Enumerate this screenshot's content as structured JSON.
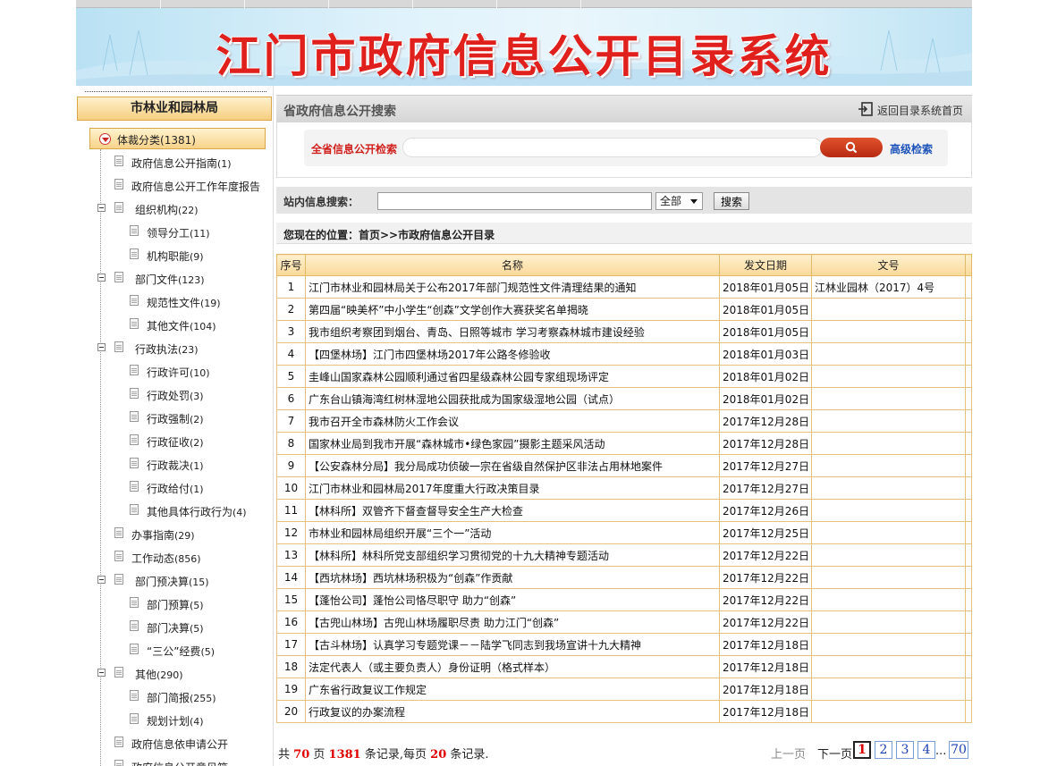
{
  "banner": {
    "title": "江门市政府信息公开目录系统"
  },
  "sidebar": {
    "header": "市林业和园林局",
    "root": {
      "label": "体裁分类",
      "count": "(1381)"
    },
    "items": [
      {
        "label": "政府信息公开指南",
        "count": "(1)",
        "level": 1,
        "type": "doc"
      },
      {
        "label": "政府信息公开工作年度报告",
        "count": "",
        "level": 1,
        "type": "doc"
      },
      {
        "label": "组织机构",
        "count": "(22)",
        "level": 1,
        "type": "folder"
      },
      {
        "label": "领导分工",
        "count": "(11)",
        "level": 2,
        "type": "doc"
      },
      {
        "label": "机构职能",
        "count": "(9)",
        "level": 2,
        "type": "doc"
      },
      {
        "label": "部门文件",
        "count": "(123)",
        "level": 1,
        "type": "folder"
      },
      {
        "label": "规范性文件",
        "count": "(19)",
        "level": 2,
        "type": "doc"
      },
      {
        "label": "其他文件",
        "count": "(104)",
        "level": 2,
        "type": "doc"
      },
      {
        "label": "行政执法",
        "count": "(23)",
        "level": 1,
        "type": "folder"
      },
      {
        "label": "行政许可",
        "count": "(10)",
        "level": 2,
        "type": "doc"
      },
      {
        "label": "行政处罚",
        "count": "(3)",
        "level": 2,
        "type": "doc"
      },
      {
        "label": "行政强制",
        "count": "(2)",
        "level": 2,
        "type": "doc"
      },
      {
        "label": "行政征收",
        "count": "(2)",
        "level": 2,
        "type": "doc"
      },
      {
        "label": "行政裁决",
        "count": "(1)",
        "level": 2,
        "type": "doc"
      },
      {
        "label": "行政给付",
        "count": "(1)",
        "level": 2,
        "type": "doc"
      },
      {
        "label": "其他具体行政行为",
        "count": "(4)",
        "level": 2,
        "type": "doc"
      },
      {
        "label": "办事指南",
        "count": "(29)",
        "level": 1,
        "type": "doc"
      },
      {
        "label": "工作动态",
        "count": "(856)",
        "level": 1,
        "type": "doc"
      },
      {
        "label": "部门预决算",
        "count": "(15)",
        "level": 1,
        "type": "folder"
      },
      {
        "label": "部门预算",
        "count": "(5)",
        "level": 2,
        "type": "doc"
      },
      {
        "label": "部门决算",
        "count": "(5)",
        "level": 2,
        "type": "doc"
      },
      {
        "label": "“三公”经费",
        "count": "(5)",
        "level": 2,
        "type": "doc"
      },
      {
        "label": "其他",
        "count": "(290)",
        "level": 1,
        "type": "folder"
      },
      {
        "label": "部门简报",
        "count": "(255)",
        "level": 2,
        "type": "doc"
      },
      {
        "label": "规划计划",
        "count": "(4)",
        "level": 2,
        "type": "doc"
      },
      {
        "label": "政府信息依申请公开",
        "count": "",
        "level": 1,
        "type": "doc"
      },
      {
        "label": "政府信息公开意见箱",
        "count": "",
        "level": 1,
        "type": "doc"
      }
    ]
  },
  "search": {
    "title": "省政府信息公开搜索",
    "back_label": "返回目录系统首页",
    "province_label": "全省信息公开检索",
    "province_value": "",
    "advanced_label": "高级检索"
  },
  "site_search": {
    "label": "站内信息搜索：",
    "value": "",
    "scope": "全部",
    "button": "搜索"
  },
  "location": {
    "text": "您现在的位置：首页>>市政府信息公开目录"
  },
  "table": {
    "headers": [
      "序号",
      "名称",
      "发文日期",
      "文号"
    ],
    "rows": [
      [
        "1",
        "江门市林业和园林局关于公布2017年部门规范性文件清理结果的通知",
        "2018年01月05日",
        "江林业园林（2017）4号"
      ],
      [
        "2",
        "第四届“映美杯”中小学生“创森”文学创作大赛获奖名单揭晓",
        "2018年01月05日",
        ""
      ],
      [
        "3",
        "我市组织考察团到烟台、青岛、日照等城市  学习考察森林城市建设经验",
        "2018年01月05日",
        ""
      ],
      [
        "4",
        "【四堡林场】江门市四堡林场2017年公路冬修验收",
        "2018年01月03日",
        ""
      ],
      [
        "5",
        "圭峰山国家森林公园顺利通过省四星级森林公园专家组现场评定",
        "2018年01月02日",
        ""
      ],
      [
        "6",
        "广东台山镇海湾红树林湿地公园获批成为国家级湿地公园（试点）",
        "2018年01月02日",
        ""
      ],
      [
        "7",
        "我市召开全市森林防火工作会议",
        "2017年12月28日",
        ""
      ],
      [
        "8",
        "国家林业局到我市开展“森林城市•绿色家园”摄影主题采风活动",
        "2017年12月28日",
        ""
      ],
      [
        "9",
        "【公安森林分局】我分局成功侦破一宗在省级自然保护区非法占用林地案件",
        "2017年12月27日",
        ""
      ],
      [
        "10",
        "江门市林业和园林局2017年度重大行政决策目录",
        "2017年12月27日",
        ""
      ],
      [
        "11",
        "【林科所】双管齐下督查督导安全生产大检查",
        "2017年12月26日",
        ""
      ],
      [
        "12",
        "市林业和园林局组织开展“三个一”活动",
        "2017年12月25日",
        ""
      ],
      [
        "13",
        "【林科所】林科所党支部组织学习贯彻党的十九大精神专题活动",
        "2017年12月22日",
        ""
      ],
      [
        "14",
        "【西坑林场】西坑林场积极为“创森”作贡献",
        "2017年12月22日",
        ""
      ],
      [
        "15",
        "【蓬怡公司】蓬怡公司恪尽职守  助力“创森”",
        "2017年12月22日",
        ""
      ],
      [
        "16",
        "【古兜山林场】古兜山林场履职尽责  助力江门“创森”",
        "2017年12月22日",
        ""
      ],
      [
        "17",
        "【古斗林场】认真学习专题党课－－陆学飞同志到我场宣讲十九大精神",
        "2017年12月18日",
        ""
      ],
      [
        "18",
        "法定代表人（或主要负责人）身份证明（格式样本）",
        "2017年12月18日",
        ""
      ],
      [
        "19",
        "广东省行政复议工作规定",
        "2017年12月18日",
        ""
      ],
      [
        "20",
        "行政复议的办案流程",
        "2017年12月18日",
        ""
      ]
    ]
  },
  "pager": {
    "prefix": "共",
    "total_pages": "70",
    "mid1": "页",
    "total_records": "1381",
    "mid2": "条记录,每页",
    "per_page": "20",
    "suffix": "条记录.",
    "prev": "上一页",
    "next": "下一页",
    "pages": [
      "1",
      "2",
      "3",
      "4"
    ],
    "ellipsis": "...",
    "last": "70"
  }
}
